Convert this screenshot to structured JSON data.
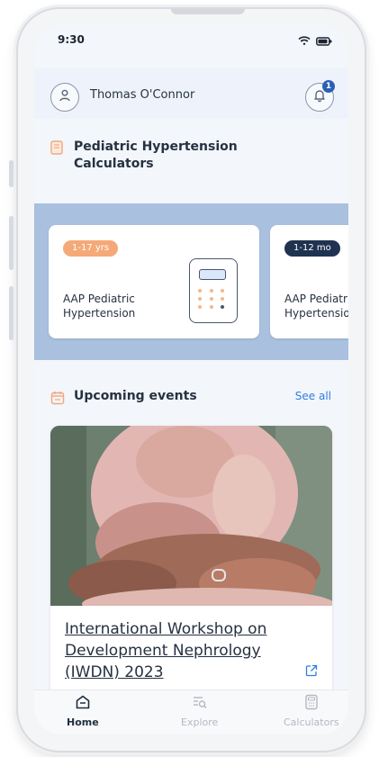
{
  "status_bar": {
    "time": "9:30"
  },
  "header": {
    "user_name": "Thomas O'Connor",
    "notification_count": "1"
  },
  "calculators_section": {
    "title": "Pediatric Hypertension Calculators",
    "cards": [
      {
        "age_label": "1-17 yrs",
        "title": "AAP Pediatric Hypertension"
      },
      {
        "age_label": "1-12 mo",
        "title": "AAP Pediatri Hypertensio"
      }
    ]
  },
  "events_section": {
    "title": "Upcoming events",
    "see_all": "See all",
    "event": {
      "title": "International Workshop on Development Nephrology (IWDN) 2023"
    }
  },
  "bottom_nav": {
    "items": [
      {
        "label": "Home"
      },
      {
        "label": "Explore"
      },
      {
        "label": "Calculators"
      }
    ]
  },
  "colors": {
    "accent": "#2f7fe0",
    "carousel_bg": "#a9c0df",
    "pill_peach": "#f5a978",
    "pill_navy": "#1f3250"
  }
}
